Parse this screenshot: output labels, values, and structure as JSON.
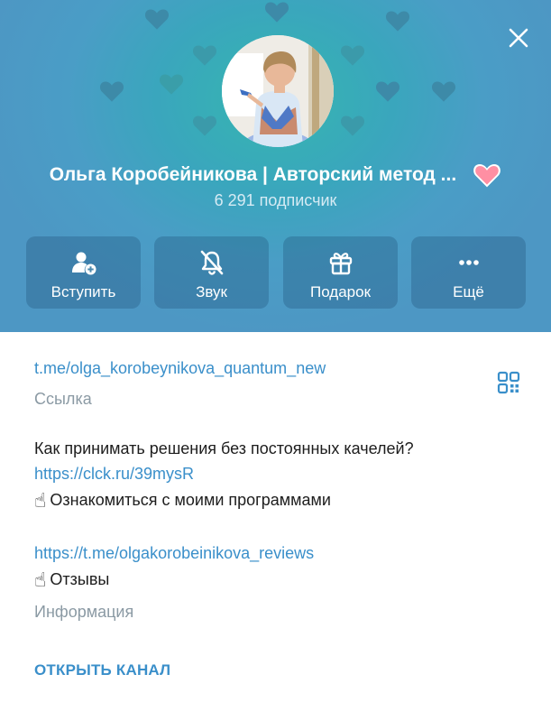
{
  "header": {
    "channel_title": "Ольга Коробейникова | Авторский метод ...",
    "subscribers": "6 291 подписчик",
    "background_color": "#4d97c4",
    "accent_color": "#35b6b0",
    "heart_color": "#3d8aa8",
    "title_heart_color": "#ff8fa3"
  },
  "actions": [
    {
      "label": "Вступить",
      "icon": "add-user-icon"
    },
    {
      "label": "Звук",
      "icon": "bell-muted-icon"
    },
    {
      "label": "Подарок",
      "icon": "gift-icon"
    },
    {
      "label": "Ещё",
      "icon": "more-dots-icon"
    }
  ],
  "info": {
    "link": "t.me/olga_korobeynikova_quantum_new",
    "link_caption": "Ссылка",
    "description_line1": "Как принимать решения без постоянных качелей?",
    "description_link1": "https://clck.ru/39mysR",
    "description_line2_emoji": "☝",
    "description_line2": "Ознакомиться с моими программами",
    "description_link2": "https://t.me/olgakorobeinikova_reviews",
    "description_line3_emoji": "☝",
    "description_line3": "Отзывы",
    "description_caption": "Информация",
    "link_color": "#3a8fca"
  },
  "footer": {
    "open_channel": "ОТКРЫТЬ КАНАЛ"
  }
}
